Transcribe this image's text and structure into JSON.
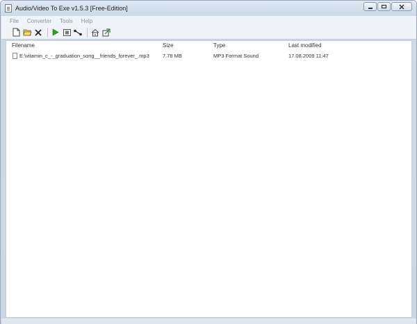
{
  "window": {
    "title": "Audio/Video To Exe v1.5.3 [Free-Edition]"
  },
  "menu": [
    "File",
    "Converter",
    "Tools",
    "Help"
  ],
  "toolbar": {
    "buttons": [
      "new-file",
      "open-folder",
      "remove",
      "play",
      "convert",
      "route",
      "home",
      "settings"
    ]
  },
  "columns": [
    "Filename",
    "Size",
    "Type",
    "Last modified"
  ],
  "files": [
    {
      "filename": "E:\\vitamin_c_-_graduation_song__friends_forever_.mp3",
      "size": "7.78 MB",
      "type": "MP3 Format Sound",
      "modified": "17.08.2009 11:47"
    }
  ],
  "colors": {
    "chrome": "#cdd9e7",
    "menu_text": "#8b93a0",
    "play_green": "#2ea02e"
  }
}
